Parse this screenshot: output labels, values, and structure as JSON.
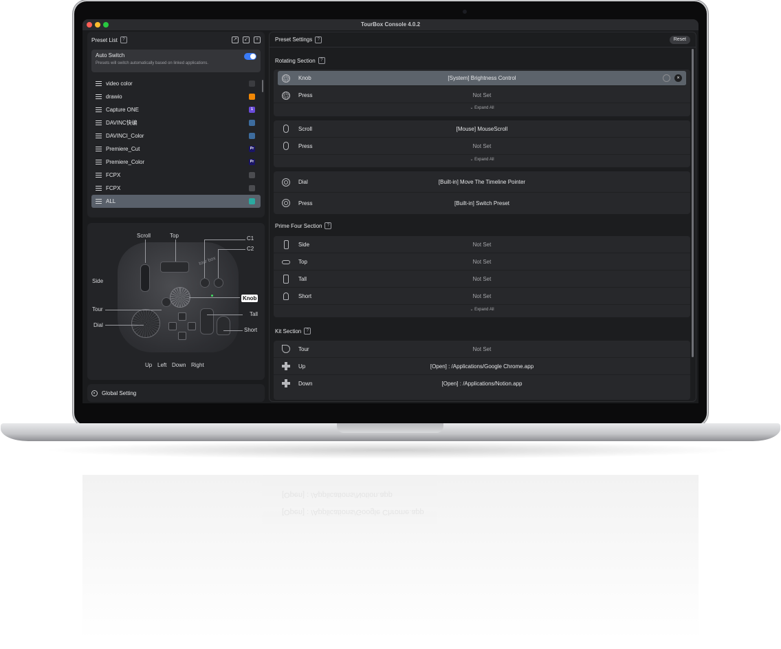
{
  "window": {
    "title": "TourBox Console 4.0.2"
  },
  "preset_list": {
    "title": "Preset List",
    "help": "?",
    "actions": [
      "export",
      "import",
      "add"
    ],
    "auto_switch": {
      "title": "Auto Switch",
      "description": "Presets will switch automatically based on linked applications.",
      "enabled": true
    },
    "items": [
      {
        "label": "video color",
        "badge": "",
        "badge_color": "#3b3c40"
      },
      {
        "label": "drawio",
        "badge": "",
        "badge_color": "#f08705"
      },
      {
        "label": "Capture ONE",
        "badge": "1",
        "badge_color": "#6a4bd9"
      },
      {
        "label": "DAVINC快编",
        "badge": "",
        "badge_color": "#3d6c9e"
      },
      {
        "label": "DAVINCI_Color",
        "badge": "",
        "badge_color": "#3d6c9e"
      },
      {
        "label": "Premiere_Cut",
        "badge": "Pr",
        "badge_color": "#1a1565"
      },
      {
        "label": "Premiere_Color",
        "badge": "Pr",
        "badge_color": "#1a1565"
      },
      {
        "label": "FCPX",
        "badge": "",
        "badge_color": "#4b4c50"
      },
      {
        "label": "FCPX",
        "badge": "",
        "badge_color": "#4b4c50"
      },
      {
        "label": "ALL",
        "badge": "",
        "badge_color": "#2aa9a0",
        "selected": true
      }
    ]
  },
  "device": {
    "labels": {
      "scroll": "Scroll",
      "top": "Top",
      "c1": "C1",
      "c2": "C2",
      "side": "Side",
      "knob": "Knob",
      "tour": "Tour",
      "tall": "Tall",
      "dial": "Dial",
      "short": "Short",
      "up": "Up",
      "left": "Left",
      "down": "Down",
      "right": "Right"
    }
  },
  "global_setting": {
    "label": "Global Setting"
  },
  "preset_settings": {
    "title": "Preset Settings",
    "reset_label": "Reset",
    "rotating": {
      "title": "Rotating Section",
      "knob": {
        "label": "Knob",
        "value": "[System] Brightness Control"
      },
      "knob_press": {
        "label": "Press",
        "value": "Not Set"
      },
      "expand1": "Expand All",
      "scroll": {
        "label": "Scroll",
        "value": "[Mouse] MouseScroll"
      },
      "scroll_press": {
        "label": "Press",
        "value": "Not Set"
      },
      "expand2": "Expand All",
      "dial": {
        "label": "Dial",
        "value": "[Built-in] Move The Timeline Pointer"
      },
      "dial_press": {
        "label": "Press",
        "value": "[Built-in] Switch Preset"
      }
    },
    "prime_four": {
      "title": "Prime Four Section",
      "side": {
        "label": "Side",
        "value": "Not Set"
      },
      "top": {
        "label": "Top",
        "value": "Not Set"
      },
      "tall": {
        "label": "Tall",
        "value": "Not Set"
      },
      "short": {
        "label": "Short",
        "value": "Not Set"
      },
      "expand": "Expand All"
    },
    "kit": {
      "title": "Kit Section",
      "tour": {
        "label": "Tour",
        "value": "Not Set"
      },
      "up": {
        "label": "Up",
        "value": "[Open] : /Applications/Google Chrome.app"
      },
      "down": {
        "label": "Down",
        "value": "[Open] : /Applications/Notion.app"
      }
    }
  }
}
